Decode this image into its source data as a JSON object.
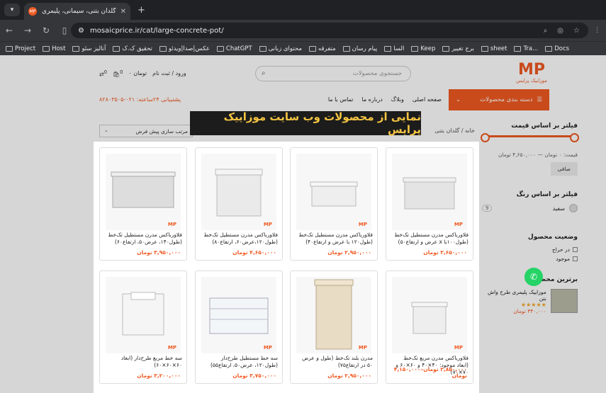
{
  "browser": {
    "tab_title": "گلدان بتنی، سیمانی، پلیمری بزرگ | ...",
    "favicon_text": "MP",
    "url": "mosaicprice.ir/cat/large-concrete-pot/",
    "bookmarks": [
      "Project",
      "Host",
      "آنالیز سئو",
      "تحقیق ک.ک",
      "عکس|صدا|ویدئو",
      "ChatGPT",
      "محتوای زبانی",
      "متفرقه",
      "پیام رسان",
      "السا",
      "Keep",
      "برج تغییر",
      "sheet",
      "Tra...",
      "Docs"
    ]
  },
  "header": {
    "logo": "MP",
    "logo_sub": "موزاییک پرایس",
    "search_placeholder": "جستجوی محصولات",
    "account": "ورود / ثبت نام",
    "cart": "۰ تومان",
    "cart_count": "0",
    "compare_count": "0",
    "categories_btn": "دسته بندی محصولات",
    "nav_links": [
      "صفحه اصلی",
      "وبلاگ",
      "درباره ما",
      "تماس با ما"
    ],
    "phone": "پشتیبانی ۲۴ساعته: ۰۲۱-۸۲۸۰۳۵۰۵"
  },
  "banner": "نمایی از محصولات وب سایت موزاییک پرایس",
  "breadcrumb": "خانه / گلدان بتنی",
  "sort_label": "مرتب سازی پیش فرض",
  "sidebar": {
    "price_title": "فیلتر بر اساس قیمت",
    "price_range": "قیمت: ۰ تومان — ۴,۶۵۰,۰۰۰ تومان",
    "filter_btn": "صافی",
    "color_title": "فیلتر بر اساس رنگ",
    "color_name": "سفید",
    "color_count": "9",
    "status_title": "وضعیت محصول",
    "status_items": [
      "در حراج",
      "موجود"
    ],
    "best_title": "برترین محصولات",
    "best_name": "موزاییک پلیمری طرح واش بتن",
    "best_stars": "★★★★★",
    "best_price": "۳۴۰,۰۰۰ تومان"
  },
  "products": [
    {
      "title": "فلاورباکس مدرن مستطیل تک‌خط (طول۱۰۰با x عرض و ارتفاع۵۰)",
      "price": "۳,۶۵۰,۰۰۰ تومان"
    },
    {
      "title": "فلاورباکس مدرن مستطیل تک‌خط (طول۱۲۰ با عرض و ارتفاع۴۰)",
      "price": "۲,۹۵۰,۰۰۰ تومان"
    },
    {
      "title": "فلاورباکس مدرن مستطیل تک‌خط (طول۱۲۰،عرض۶۰، ارتفاع۸۰)",
      "price": "۴,۶۵۰,۰۰۰ تومان"
    },
    {
      "title": "فلاورباکس مدرن مستطیل تک‌خط (طول۱۴۰، عرض۵۰، ارتفاع۶۰)",
      "price": "۳,۹۵۰,۰۰۰ تومان"
    },
    {
      "title": "فلاورباکس مدرن مربع تک‌خط (ابعاد موجود: ۴۰×۴۰ و ۶۰×۶۰ و ۷۰×۷۰)",
      "price": "۲,۸۵۰,۰۰۰ تومان–۴,۱۵۰,۰۰۰ تومان"
    },
    {
      "title": "مدرن بلند تک‌خط (طول و عرض ۵۰ در ارتفاع۷۵)",
      "price": "۲,۹۵۰,۰۰۰ تومان"
    },
    {
      "title": "سه خط مستطیل طرح‌دار (طول۱۲۰، عرض۵۰، ارتفاع۵۵)",
      "price": "۳,۷۵۰,۰۰۰ تومان"
    },
    {
      "title": "سه خط مربع طرح‌دار (ابعاد ۶۰×۶۰×۶۰)",
      "price": "۳,۲۰۰,۰۰۰ تومان"
    }
  ]
}
